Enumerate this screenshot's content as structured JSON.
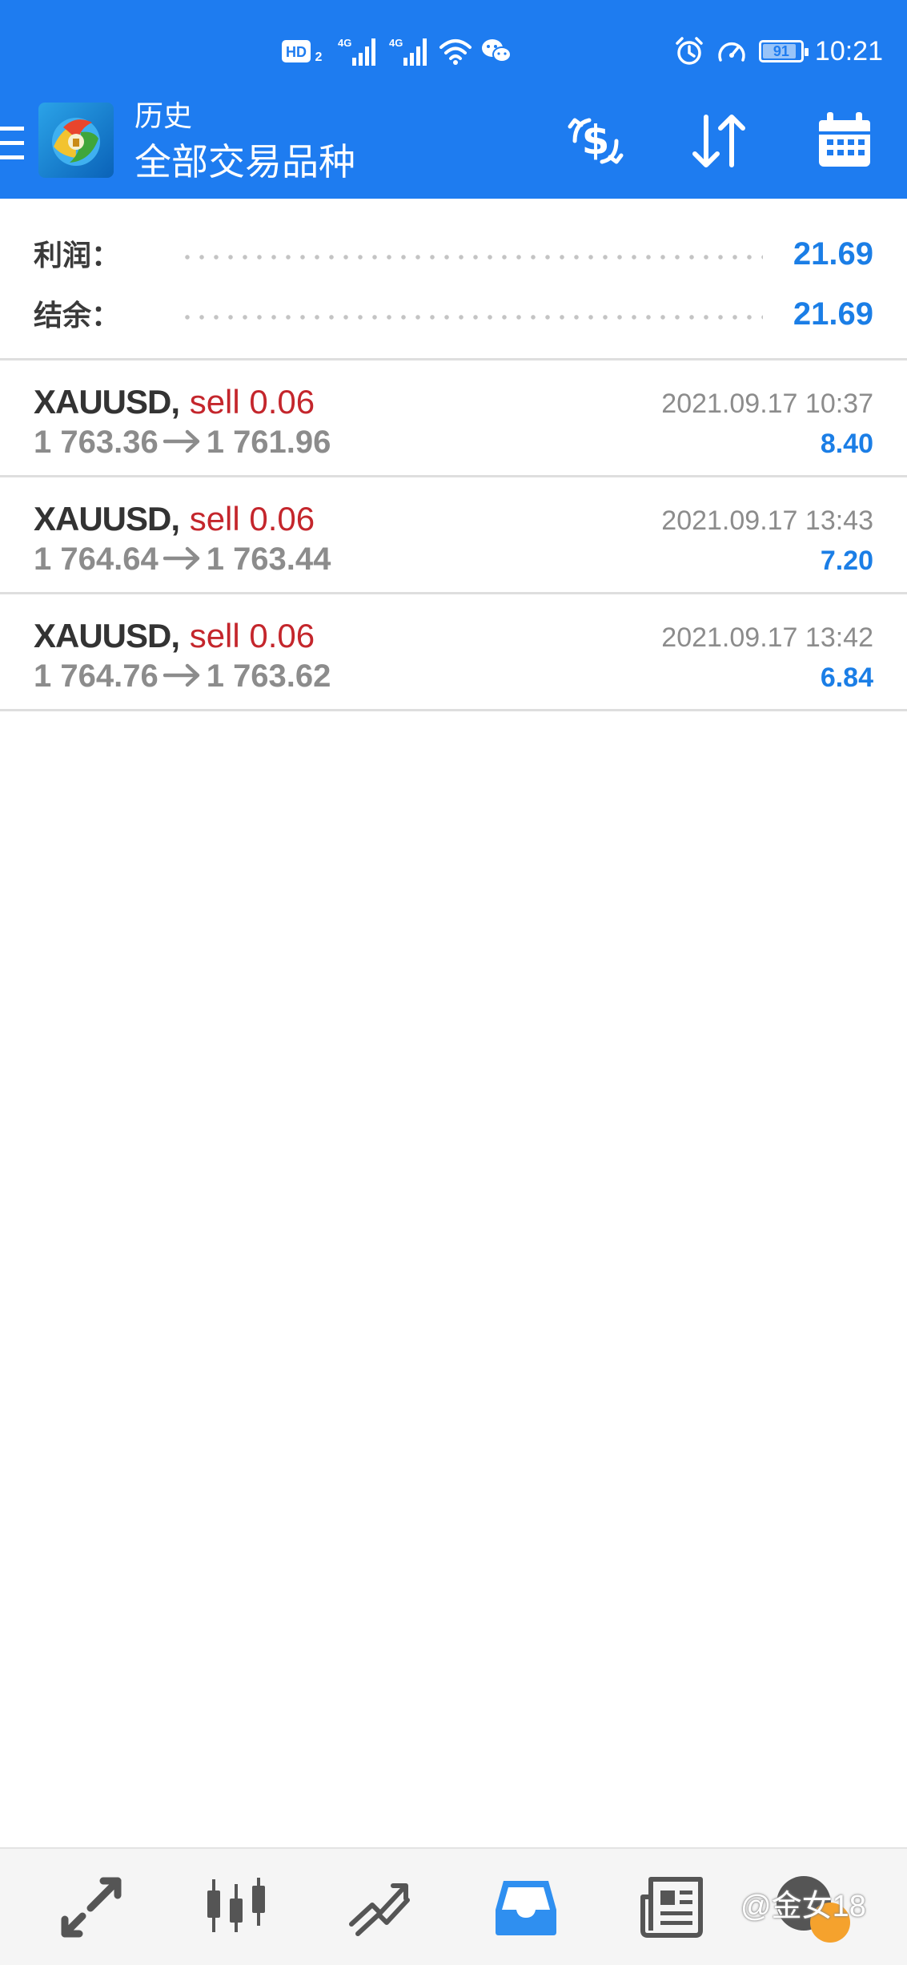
{
  "status_bar": {
    "network_badge": "HD",
    "network_sub": "2",
    "sim1_label": "4G",
    "sim2_label": "4G",
    "battery_level": "91",
    "battery_fraction": 0.91,
    "time": "10:21"
  },
  "header": {
    "title": "历史",
    "subtitle": "全部交易品种"
  },
  "summary": {
    "profit_label": "利润：",
    "profit_value": "21.69",
    "balance_label": "结余：",
    "balance_value": "21.69"
  },
  "trades": [
    {
      "symbol": "XAUUSD",
      "separator": ",",
      "side": "sell 0.06",
      "open_price": "1 763.36",
      "close_price": "1 761.96",
      "time": "2021.09.17 10:37",
      "profit": "8.40"
    },
    {
      "symbol": "XAUUSD",
      "separator": ",",
      "side": "sell 0.06",
      "open_price": "1 764.64",
      "close_price": "1 763.44",
      "time": "2021.09.17 13:43",
      "profit": "7.20"
    },
    {
      "symbol": "XAUUSD",
      "separator": ",",
      "side": "sell 0.06",
      "open_price": "1 764.76",
      "close_price": "1 763.62",
      "time": "2021.09.17 13:42",
      "profit": "6.84"
    }
  ],
  "bottom_nav": {
    "items": [
      {
        "icon": "quotes-icon",
        "active": false
      },
      {
        "icon": "chart-icon",
        "active": false
      },
      {
        "icon": "trade-icon",
        "active": false
      },
      {
        "icon": "history-icon",
        "active": true
      },
      {
        "icon": "news-icon",
        "active": false
      },
      {
        "icon": "chat-icon",
        "active": false
      }
    ]
  },
  "watermark": "@金女18",
  "colors": {
    "header_bg": "#1e7cf0",
    "value_blue": "#1b7ee6",
    "sell_red": "#c4262c",
    "muted_gray": "#8c8c8c",
    "active_nav": "#2f8ff0",
    "inactive_nav": "#555555"
  }
}
